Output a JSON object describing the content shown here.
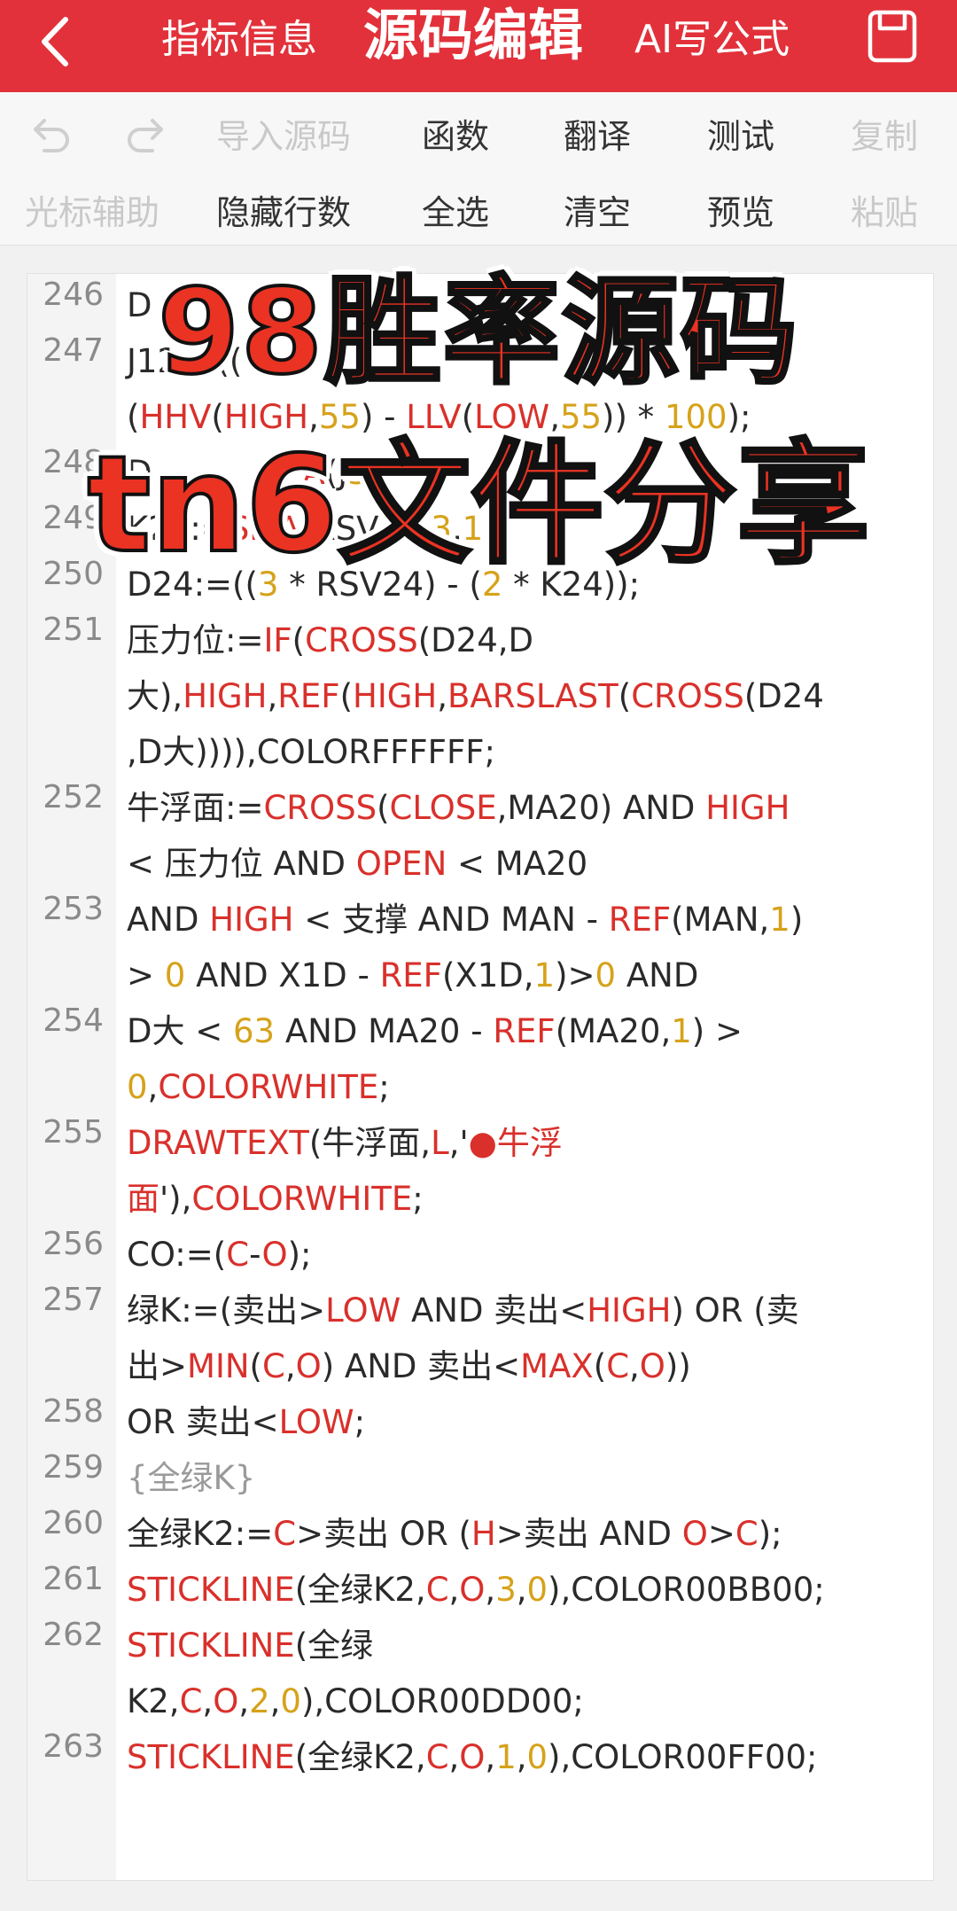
{
  "topbar": {
    "tab_info": "指标信息",
    "tab_edit": "源码编辑",
    "tab_ai": "AI写公式"
  },
  "toolbar": {
    "row1": {
      "import": "导入源码",
      "functions": "函数",
      "translate": "翻译",
      "test": "测试",
      "copy": "复制"
    },
    "row2": {
      "cursor": "光标辅助",
      "hide_lines": "隐藏行数",
      "select_all": "全选",
      "clear": "清空",
      "preview": "预览",
      "paste": "粘贴"
    }
  },
  "overlay": {
    "line1": "98胜率源码",
    "line2": "tn6文件分享"
  },
  "colors": {
    "brand": "#e2313a",
    "keyword": "#d9302b",
    "number": "#d6a21a"
  },
  "code": {
    "ln": {
      "l246": "246",
      "l247": "247",
      "l248": "248",
      "l249": "249",
      "l250": "250",
      "l251": "251",
      "l252": "252",
      "l253": "253",
      "l254": "254",
      "l255": "255",
      "l256": "256",
      "l257": "257",
      "l258": "258",
      "l259": "259",
      "l260": "260",
      "l261": "261",
      "l262": "262",
      "l263": "263"
    },
    "t": {
      "a": "D",
      "b": "大",
      "c": "J12:=((",
      "d": "(",
      "e": "HHV",
      "f": "(",
      "g": "HIGH",
      "h": ",",
      "i": "55",
      "j": ")",
      "k": "LLV",
      "l": "LOW",
      "m": ",",
      "n": "55",
      "o": ")) * ",
      "p": "100",
      "q": ");",
      "r": "D",
      "s": "A",
      "t": "(J",
      "u": "3",
      "v": ",",
      "w": "K24:=",
      "x": "SMA",
      "y": "(RSV24,",
      "z": "3",
      "aa": ",",
      "ab": "1",
      "ac": ");",
      "ad": "D24:=((",
      "ae": "3",
      "af": " * RSV24) - (",
      "ag": "2",
      "ah": " * K24));",
      "ai": "压力位:=",
      "aj": "IF",
      "ak": "(",
      "al": "CROSS",
      "am": "(D24,D",
      "an": "大),",
      "ao": "HIGH",
      "ap": ",",
      "aq": "REF",
      "ar": "(",
      "as": "HIGH",
      "at": ",",
      "au": "BARSLAST",
      "av": "(",
      "aw": "CROSS",
      "ax": "(D24",
      "ay": ",D大)))),COLORFFFFFF;",
      "az": "牛浮面:=",
      "ba": "CROSS",
      "bb": "(",
      "bc": "CLOSE",
      "bd": ",MA20) AND ",
      "be": "HIGH",
      "bf": "< 压力位 AND ",
      "bg": "OPEN",
      "bh": " < MA20",
      "bi": "AND ",
      "bj": "HIGH",
      "bk": " < 支撑 AND MAN - ",
      "bl": "REF",
      "bm": "(MAN,",
      "bn": "1",
      "bo": ")",
      "bp": "> ",
      "bq": "0",
      "br": " AND X1D - ",
      "bs": "REF",
      "bt": "(X1D,",
      "bu": "1",
      "bv": ")>",
      "bw": "0",
      "bx": " AND",
      "by": "D大 < ",
      "bz": "63",
      "ca": " AND MA20 - ",
      "cb": "REF",
      "cc": "(MA20,",
      "cd": "1",
      "ce": ") >",
      "cf": "0",
      "cg": ",",
      "ch": "COLORWHITE",
      "ci": ";",
      "cj": "DRAWTEXT",
      "ck": "(牛浮面,",
      "cl": "L",
      "cm": ",'",
      "cn": "●",
      "co": "牛浮",
      "cp": "面",
      "cq": "'),",
      "cr": "COLORWHITE",
      "cs": ";",
      "ct": "CO:=(",
      "cu": "C",
      "cv": "-",
      "cw": "O",
      "cx": ");",
      "cy": "绿K:=(卖出>",
      "cz": "LOW",
      "da": " AND 卖出<",
      "db": "HIGH",
      "dc": ") OR (卖",
      "dd": "出>",
      "de": "MIN",
      "df": "(",
      "dg": "C",
      "dh": ",",
      "di": "O",
      "dj": ") AND 卖出<",
      "dk": "MAX",
      "dl": "(",
      "dm": "C",
      "dn": ",",
      "do": "O",
      "dp": "))",
      "dq": "OR 卖出<",
      "dr": "LOW",
      "ds": ";",
      "dt": "{全绿K}",
      "du": "全绿K2:=",
      "dv": "C",
      "dw": ">卖出 OR (",
      "dx": "H",
      "dy": ">卖出 AND ",
      "dz": "O",
      "ea": ">",
      "eb": "C",
      "ec": ");",
      "ed": "STICKLINE",
      "ee": "(全绿K2,",
      "ef": "C",
      "eg": ",",
      "eh": "O",
      "ei": ",",
      "ej": "3",
      "ek": ",",
      "el": "0",
      "em": "),COLOR00BB00;",
      "en": "STICKLINE",
      "eo": "(全绿",
      "ep": "K2,",
      "eq": "C",
      "er": ",",
      "es": "O",
      "et": ",",
      "eu": "2",
      "ev": ",",
      "ew": "0",
      "ex": "),COLOR00DD00;",
      "ey": "STICKLINE",
      "ez": "(全绿K2,",
      "fa": "C",
      "fb": ",",
      "fc": "O",
      "fd": ",",
      "fe": "1",
      "ff": ",",
      "fg": "0",
      "fh": "),COLOR00FF00;"
    }
  }
}
